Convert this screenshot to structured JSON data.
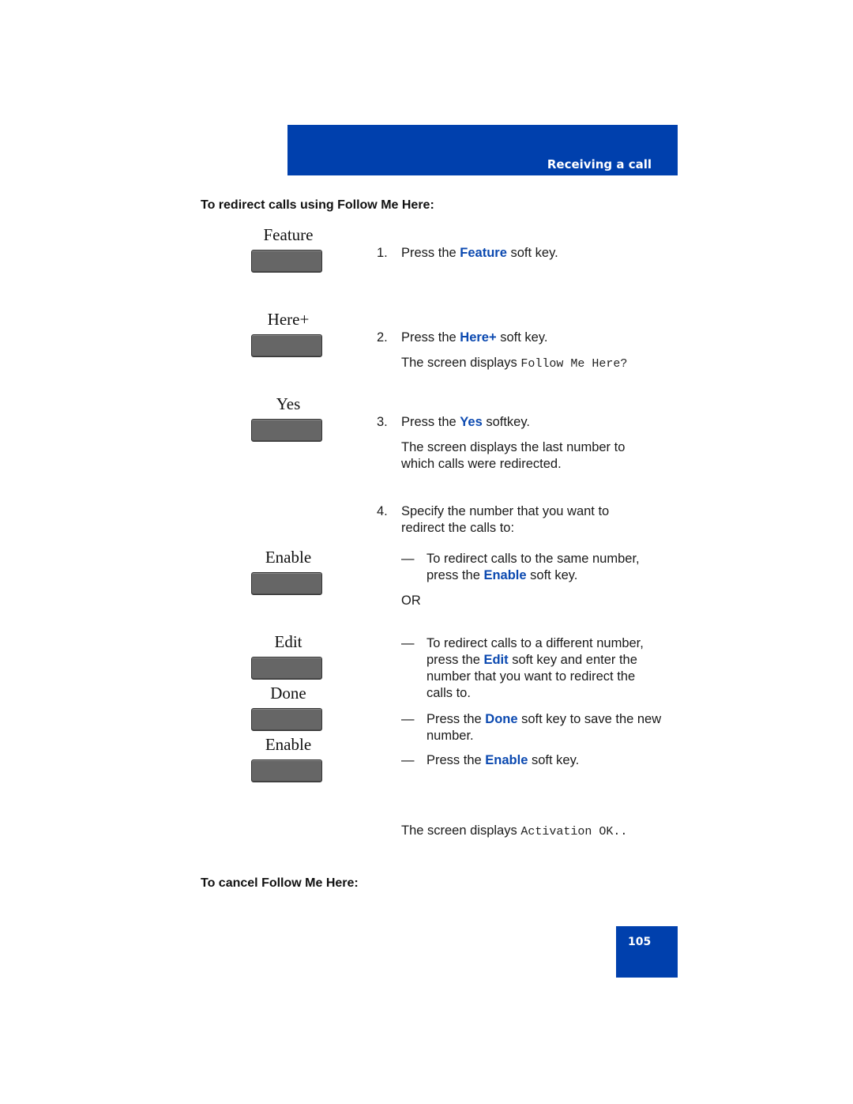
{
  "header": {
    "title": "Receiving a call",
    "band_color": "#0040ad"
  },
  "section_heading": "To redirect calls using Follow Me Here:",
  "softkeys": [
    {
      "label": "Feature"
    },
    {
      "label": "Here+"
    },
    {
      "label": "Yes"
    },
    {
      "label": "Enable"
    },
    {
      "label": "Edit"
    },
    {
      "label": "Done"
    },
    {
      "label": "Enable"
    }
  ],
  "steps": [
    {
      "number": "1.",
      "pre": "Press the ",
      "keyword": "Feature",
      "post": " soft key."
    },
    {
      "number": "2.",
      "pre": "Press the ",
      "keyword": "Here+",
      "post": " soft key.",
      "note_pre": "The screen displays ",
      "note_mono": "Follow Me Here?"
    },
    {
      "number": "3.",
      "pre": "Press the ",
      "keyword": "Yes",
      "post": " softkey.",
      "note": "The screen displays the last number to which calls were redirected."
    },
    {
      "number": "4.",
      "text": "Specify the number that you want to redirect the calls to:"
    }
  ],
  "sub_items": [
    {
      "dash": "—",
      "pre": "To redirect calls to the same number, press the ",
      "keyword": "Enable",
      "post": " soft key."
    },
    {
      "dash": "—",
      "pre": "To redirect calls to a different number, press the ",
      "keyword": "Edit",
      "post": " soft key and enter the number that you want to redirect the calls to."
    },
    {
      "dash": "—",
      "pre": "Press the ",
      "keyword": "Done",
      "post": " soft key to save the new number."
    },
    {
      "dash": "—",
      "pre": "Press the ",
      "keyword": "Enable",
      "post": " soft key."
    }
  ],
  "or_label": "OR",
  "final_note": {
    "pre": "The screen displays ",
    "mono": "Activation OK.."
  },
  "cancel_heading": "To cancel Follow Me Here:",
  "page_number": "105",
  "colors": {
    "keyword": "#0b49b0",
    "softkey": "#666666"
  }
}
